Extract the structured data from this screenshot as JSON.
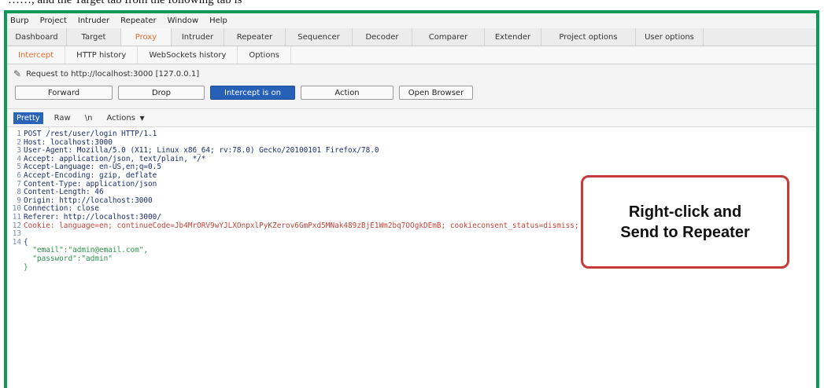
{
  "caption": {
    "text": ", and the Target tab from the following tab is "
  },
  "menubar": [
    "Burp",
    "Project",
    "Intruder",
    "Repeater",
    "Window",
    "Help"
  ],
  "main_tabs": [
    {
      "label": "Dashboard",
      "active": false
    },
    {
      "label": "Target",
      "active": false
    },
    {
      "label": "Proxy",
      "active": true
    },
    {
      "label": "Intruder",
      "active": false
    },
    {
      "label": "Repeater",
      "active": false
    },
    {
      "label": "Sequencer",
      "active": false
    },
    {
      "label": "Decoder",
      "active": false
    },
    {
      "label": "Comparer",
      "active": false
    },
    {
      "label": "Extender",
      "active": false
    },
    {
      "label": "Project options",
      "active": false
    },
    {
      "label": "User options",
      "active": false
    }
  ],
  "sub_tabs": [
    {
      "label": "Intercept",
      "active": true
    },
    {
      "label": "HTTP history",
      "active": false
    },
    {
      "label": "WebSockets history",
      "active": false
    },
    {
      "label": "Options",
      "active": false
    }
  ],
  "request_info": "Request to http://localhost:3000 [127.0.0.1]",
  "buttons": {
    "forward": "Forward",
    "drop": "Drop",
    "intercept": "Intercept is on",
    "action": "Action",
    "open_browser": "Open Browser"
  },
  "editor_tabs": {
    "pretty": "Pretty",
    "raw": "Raw",
    "newline": "\\n",
    "actions": "Actions"
  },
  "code_lines": [
    {
      "n": "1",
      "text": "POST /rest/user/login HTTP/1.1"
    },
    {
      "n": "2",
      "text": "Host: localhost:3000"
    },
    {
      "n": "3",
      "text": "User-Agent: Mozilla/5.0 (X11; Linux x86_64; rv:78.0) Gecko/20100101 Firefox/78.0"
    },
    {
      "n": "4",
      "text": "Accept: application/json, text/plain, */*"
    },
    {
      "n": "5",
      "text": "Accept-Language: en-US,en;q=0.5"
    },
    {
      "n": "6",
      "text": "Accept-Encoding: gzip, deflate"
    },
    {
      "n": "7",
      "text": "Content-Type: application/json"
    },
    {
      "n": "8",
      "text": "Content-Length: 46"
    },
    {
      "n": "9",
      "text": "Origin: http://localhost:3000"
    },
    {
      "n": "10",
      "text": "Connection: close"
    },
    {
      "n": "11",
      "text": "Referer: http://localhost:3000/"
    },
    {
      "n": "12",
      "text": "Cookie: language=en; continueCode=Jb4MrORV9wYJLXOnpxlPyKZerov6GmPxd5MNak489zBjE1Wm2bq7OOgkDEmB; cookieconsent_status=dismiss;"
    },
    {
      "n": "13",
      "text": ""
    },
    {
      "n": "14",
      "text": "{"
    },
    {
      "n": "",
      "text": "  \"email\":\"admin@email.com\","
    },
    {
      "n": "",
      "text": "  \"password\":\"admin\""
    },
    {
      "n": "",
      "text": "}"
    }
  ],
  "callout": {
    "line1": "Right-click and",
    "line2": "Send to Repeater"
  },
  "colors": {
    "frame": "#0d9a55",
    "active_tab": "#e36a2a",
    "primary_button": "#2760b7",
    "callout_border": "#c63a3a"
  }
}
